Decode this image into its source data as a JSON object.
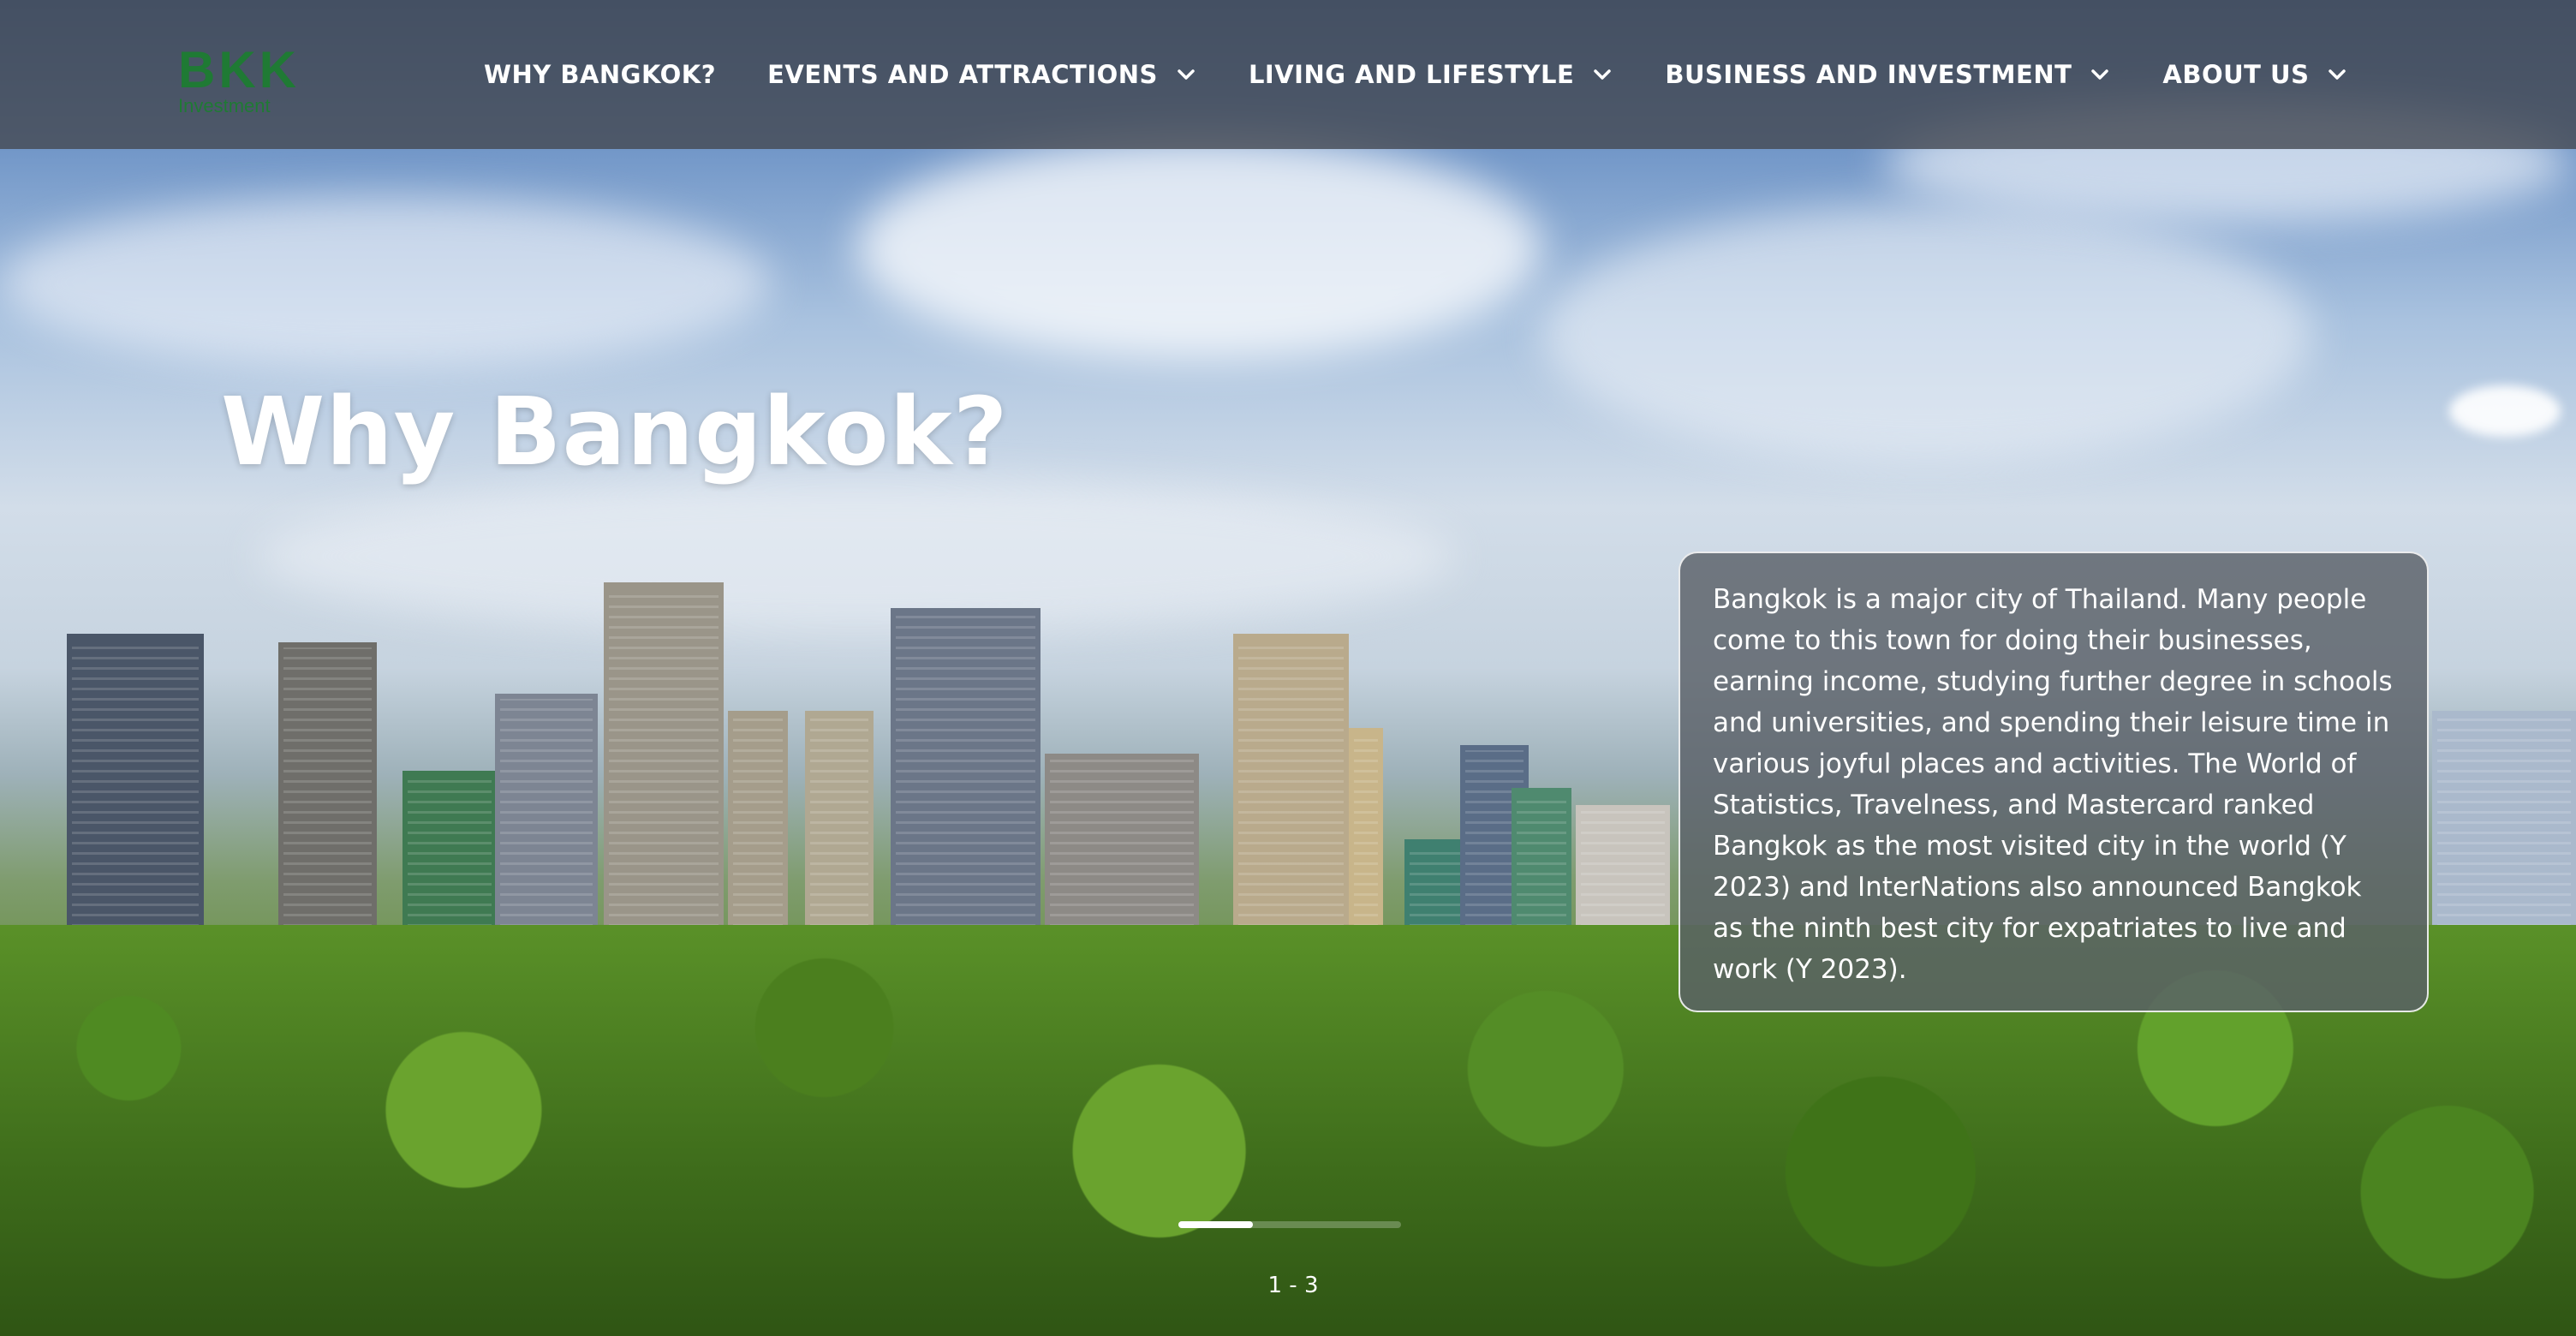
{
  "logo": {
    "main": "BKK",
    "sub": "Investment"
  },
  "nav": {
    "items": [
      {
        "label": "WHY BANGKOK?",
        "has_dropdown": false
      },
      {
        "label": "EVENTS AND ATTRACTIONS",
        "has_dropdown": true
      },
      {
        "label": "LIVING AND LIFESTYLE",
        "has_dropdown": true
      },
      {
        "label": "BUSINESS AND INVESTMENT",
        "has_dropdown": true
      },
      {
        "label": "ABOUT US",
        "has_dropdown": true
      }
    ]
  },
  "hero": {
    "title": "Why Bangkok?",
    "description": "Bangkok is a major city of Thailand. Many people come to this town for doing their businesses, earning income, studying further degree in schools and universities, and spending their leisure time in various joyful places and activities. The World of Statistics, Travelness, and Mastercard ranked Bangkok as the most visited city in the world (Y 2023) and InterNations also announced Bangkok as the ninth best city for expatriates to live and work (Y 2023)."
  },
  "slider": {
    "counter": "1 - 3",
    "progress": 0.333
  },
  "colors": {
    "brand_green": "#1f7a34",
    "topbar": "#464a54"
  },
  "icons": {
    "dropdown": "chevron-down-icon"
  }
}
